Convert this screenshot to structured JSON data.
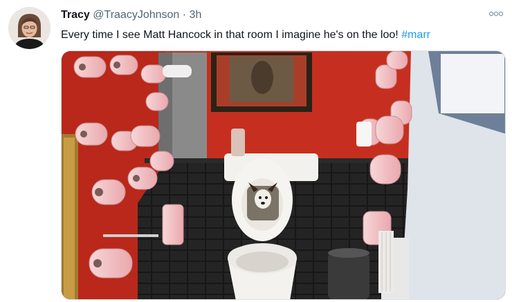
{
  "tweet": {
    "display_name": "Tracy",
    "handle": "@TraacyJohnson",
    "separator": "·",
    "time": "3h",
    "text": "Every time I see Matt Hancock in that room I imagine he's on the loo!",
    "hashtag": "#marr"
  },
  "icons": {
    "more": "more-dots-icon",
    "avatar": "user-avatar"
  },
  "colors": {
    "hashtag": "#1d9bf0",
    "wall_red": "#c8301f",
    "tile_black": "#1b1b1b",
    "toilet_roll_pink": "#f2c9cb"
  }
}
